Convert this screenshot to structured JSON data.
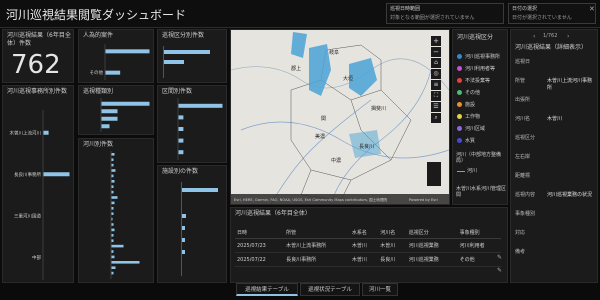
{
  "header": {
    "title": "河川巡視結果閲覧ダッシュボード",
    "filter1": {
      "label": "巡視日時範囲",
      "value": "対象となる範囲が選択されていません"
    },
    "filter2": {
      "label": "日付の選択",
      "value": "日付が選択されていません"
    }
  },
  "count_card": {
    "title": "河川巡視結果（6年目全体）件数",
    "value": "762"
  },
  "panels": {
    "kind": {
      "title": "人為的案件"
    },
    "top_right": {
      "title": "巡視区分別件数"
    },
    "office": {
      "title": "河川巡視事務所別件数"
    },
    "category": {
      "title": "巡視種類別"
    },
    "river": {
      "title": "河川別件数"
    },
    "section": {
      "title": "区間別件数"
    },
    "facility": {
      "title": "施設別の件数"
    }
  },
  "chart_data": [
    {
      "type": "bar",
      "panel": "kind",
      "categories": [
        "",
        "",
        "その他"
      ],
      "values": [
        3,
        0,
        1
      ]
    },
    {
      "type": "bar",
      "panel": "office",
      "categories": [
        "木曽川上流河川",
        "長良川事務所",
        "三重河川国道",
        "中部"
      ],
      "values": [
        8,
        41,
        0,
        0
      ]
    },
    {
      "type": "bar",
      "panel": "category",
      "categories": [
        "",
        "",
        "",
        ""
      ],
      "values": [
        6,
        2,
        2,
        1
      ]
    },
    {
      "type": "bar",
      "panel": "section",
      "categories": [
        "",
        "",
        "",
        "",
        ""
      ],
      "values": [
        9,
        1,
        1,
        1,
        1
      ]
    }
  ],
  "map": {
    "labels": [
      "岐阜",
      "大垣",
      "関",
      "美濃",
      "長良川",
      "郡上",
      "揖斐川",
      "中濃"
    ],
    "attribution": "Esri, HERE, Garmin, FAO, NOAA, USGS, Esri Community Maps contributors, 国土地理院",
    "powered": "Powered by Esri"
  },
  "legend": {
    "title": "河川巡視区分",
    "items": [
      {
        "label": "河川巡視事務所",
        "color": "#3a87c8"
      },
      {
        "label": "河川利用者等",
        "color": "#c84fd0"
      },
      {
        "label": "不法投棄等",
        "color": "#e0443c"
      },
      {
        "label": "その他",
        "color": "#4fb87d"
      },
      {
        "label": "施設",
        "color": "#e89030"
      },
      {
        "label": "工作物",
        "color": "#e6d24a"
      },
      {
        "label": "河川区域",
        "color": "#8a6ad6"
      },
      {
        "label": "水質",
        "color": "#4a4ad0"
      }
    ],
    "river_title": "河川（中部地方整備局）",
    "river_item": "河川",
    "extra_title": "木曽川水系河川管理区間"
  },
  "details": {
    "title": "河川巡視結果（詳細表示）",
    "page": "1/762",
    "rows": [
      {
        "k": "巡視日",
        "v": ""
      },
      {
        "k": "所管",
        "v": "木曽川上流河川事務所"
      },
      {
        "k": "出張所",
        "v": ""
      },
      {
        "k": "河川名",
        "v": "木曽川"
      },
      {
        "k": "巡視区分",
        "v": ""
      },
      {
        "k": "左右岸",
        "v": ""
      },
      {
        "k": "距離標",
        "v": ""
      },
      {
        "k": "巡視内容",
        "v": "河川巡視業務の状況"
      },
      {
        "k": "事象種別",
        "v": ""
      },
      {
        "k": "対応",
        "v": ""
      },
      {
        "k": "備考",
        "v": ""
      }
    ]
  },
  "table": {
    "title": "河川巡視結果（6年目全体）",
    "columns": [
      "日時",
      "所管",
      "水系名",
      "河川名",
      "巡視区分",
      "事象種別"
    ],
    "rows": [
      [
        "2025/07/23",
        "木曽川上流事務所",
        "木曽川",
        "木曽川",
        "河川巡視業務",
        "河川利用者"
      ],
      [
        "2025/07/22",
        "長良川事務所",
        "木曽川",
        "長良川",
        "河川巡視業務",
        "その他"
      ]
    ]
  },
  "tabs": [
    "巡視結果テーブル",
    "巡視状況テーブル",
    "河川一覧"
  ]
}
